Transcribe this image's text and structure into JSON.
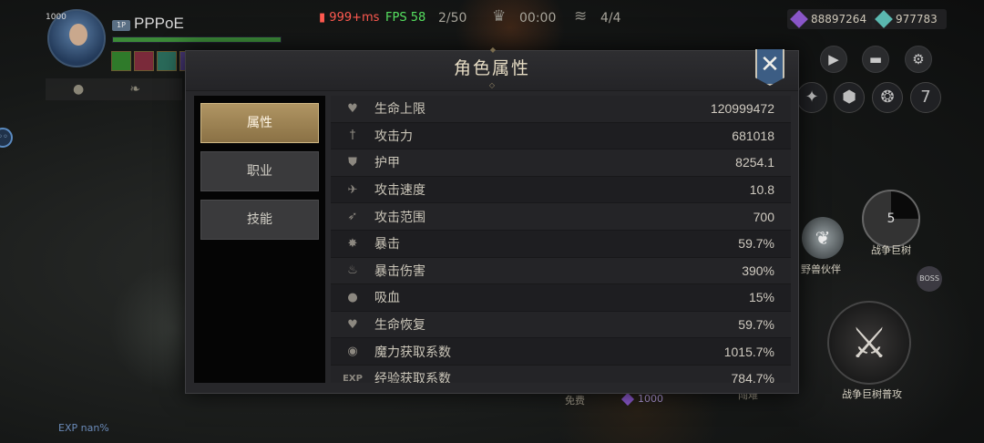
{
  "hud": {
    "level": "1000",
    "player_badge": "1P",
    "player_name": "PPPoE",
    "hp_fill": 1.0,
    "ping": "999+ms",
    "fps": "FPS 58",
    "wave": "2/50",
    "timer": "00:00",
    "charges": "4/4",
    "currency_purple": "88897264",
    "currency_teal": "977783",
    "exp_text": "EXP nan%",
    "fee_label": "免费",
    "fee_cost": "1000",
    "partial_label": "闯难",
    "cd_count": "5",
    "skill_tree_name": "战争巨树",
    "partner_name": "野兽伙伴",
    "boss_label": "BOSS",
    "attack_name": "战争巨树普攻",
    "slot_number": "7",
    "colors": {
      "hp": "#3b8a38",
      "ping": "#ff5a50",
      "fps": "#56e060",
      "close": "#3c5d84",
      "active_tab": "#a68b5a"
    }
  },
  "panel": {
    "title": "角色属性",
    "tabs": [
      {
        "label": "属性",
        "active": true
      },
      {
        "label": "职业",
        "active": false
      },
      {
        "label": "技能",
        "active": false
      }
    ],
    "stats": [
      {
        "icon": "heart-icon",
        "glyph": "♥",
        "label": "生命上限",
        "value": "120999472"
      },
      {
        "icon": "sword-icon",
        "glyph": "†",
        "label": "攻击力",
        "value": "681018"
      },
      {
        "icon": "shield-icon",
        "glyph": "⛊",
        "label": "护甲",
        "value": "8254.1"
      },
      {
        "icon": "wing-icon",
        "glyph": "✈",
        "label": "攻击速度",
        "value": "10.8"
      },
      {
        "icon": "arrow-icon",
        "glyph": "➶",
        "label": "攻击范围",
        "value": "700"
      },
      {
        "icon": "burst-icon",
        "glyph": "✸",
        "label": "暴击",
        "value": "59.7%"
      },
      {
        "icon": "flame-icon",
        "glyph": "♨",
        "label": "暴击伤害",
        "value": "390%"
      },
      {
        "icon": "drop-icon",
        "glyph": "●",
        "label": "吸血",
        "value": "15%"
      },
      {
        "icon": "heal-icon",
        "glyph": "♥",
        "label": "生命恢复",
        "value": "59.7%"
      },
      {
        "icon": "mana-icon",
        "glyph": "◉",
        "label": "魔力获取系数",
        "value": "1015.7%"
      },
      {
        "icon": "exp-icon",
        "glyph": "EXP",
        "label": "经验获取系数",
        "value": "784.7%"
      }
    ]
  }
}
